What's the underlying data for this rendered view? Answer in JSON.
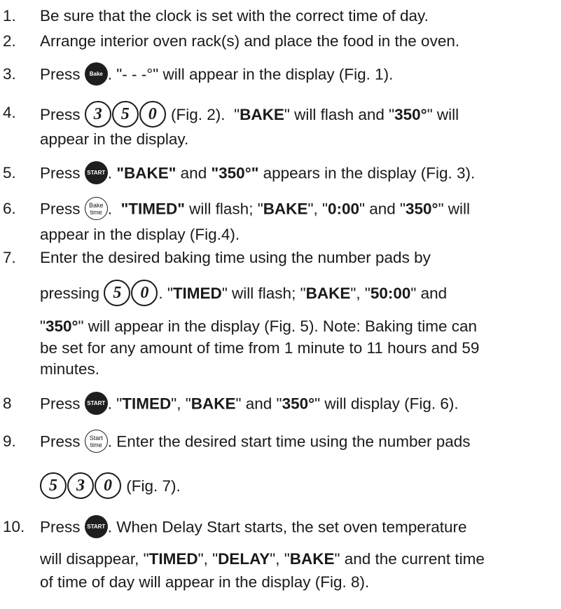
{
  "icons": {
    "bake": "Bake",
    "start": "START",
    "bake_time": [
      "Bake",
      "time"
    ],
    "start_time": [
      "Start",
      "time"
    ]
  },
  "steps": [
    {
      "number": "1.",
      "text": "Be sure that the clock is set with the correct time of day."
    },
    {
      "number": "2.",
      "text": "Arrange interior oven rack(s) and place the food in the oven."
    },
    {
      "number": "3.",
      "press": "Press",
      "after_icon": ". \"- - -°\" will appear in the display (Fig. 1)."
    },
    {
      "number": "4.",
      "press": "Press",
      "keys": [
        "3",
        "5",
        "0"
      ],
      "fig": "(Fig. 2).",
      "q1": "\"",
      "bake": "BAKE",
      "q2": "\" will flash and \"",
      "temp": "350°",
      "q3": "\" will",
      "line2": "appear in the display."
    },
    {
      "number": "5.",
      "press": "Press",
      "sep": ".",
      "bake_q": "\"BAKE\"",
      "and": "and",
      "temp_q": "\"350°\"",
      "rest": "appears in the display (Fig. 3)."
    },
    {
      "number": "6.",
      "press": "Press",
      "sep": ".",
      "timed_q": "\"TIMED\"",
      "mid1": "will flash; \"",
      "bake": "BAKE",
      "mid2": "\",  \"",
      "time": "0:00",
      "mid3": "\"  and \"",
      "temp": "350°",
      "end": "\" will",
      "line2": "appear in the display (Fig.4)."
    },
    {
      "number": "7.",
      "line1": "Enter the desired baking time using the number pads by",
      "pressing": "pressing",
      "keys": [
        "5",
        "0"
      ],
      "a1": ". \"",
      "timed": "TIMED",
      "a2": "\" will flash; \"",
      "bake": "BAKE",
      "a3": "\", \"",
      "time": "50:00",
      "a4": "\"  and",
      "l3q": "\"",
      "temp": "350°",
      "l3rest": "\" will appear in the display (Fig. 5). Note: Baking time can",
      "line4": "be set for any amount of time from 1 minute to 11 hours and 59",
      "line5": "minutes."
    },
    {
      "number": "8",
      "press": "Press",
      "a1": ". \"",
      "timed": "TIMED",
      "a2": "\", \"",
      "bake": "BAKE",
      "a3": "\" and \"",
      "temp": "350°",
      "a4": "\" will display (Fig. 6)."
    },
    {
      "number": "9.",
      "press": "Press",
      "a1": ".  Enter the desired start time using the number pads",
      "keys": [
        "5",
        "3",
        "0"
      ],
      "fig": "(Fig. 7)."
    },
    {
      "number": "10.",
      "press": "Press",
      "a1": ". When Delay Start starts, the set oven temperature",
      "l2a": "will disappear, \"",
      "timed": "TIMED",
      "l2b": "\", \"",
      "delay": "DELAY",
      "l2c": "\", \"",
      "bake": "BAKE",
      "l2d": "\" and the current time",
      "line3": "of time of day will appear in the display (Fig. 8)."
    }
  ]
}
